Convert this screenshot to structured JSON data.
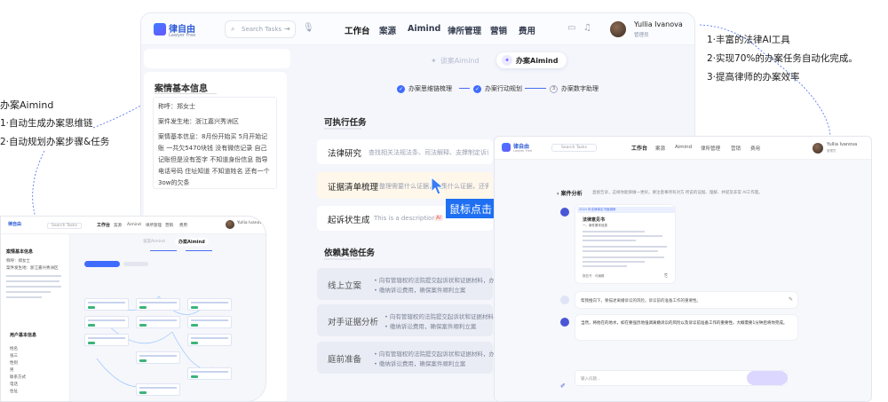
{
  "left_annotation": {
    "title": "办案Aimind",
    "lines": [
      "1·自动生成办案思维链",
      "2·自动规划办案步骤&任务"
    ]
  },
  "right_annotation": {
    "lines": [
      "1·丰富的法律AI工具",
      "2·实现70%的办案任务自动化完成。",
      "3·提高律师的办案效率"
    ]
  },
  "header": {
    "logo_name": "律自由",
    "logo_sub": "Lawyer Free",
    "search_placeholder": "Search Tasks",
    "nav": [
      "工作台",
      "案源",
      "Aimind",
      "律所管理",
      "营销",
      "费用"
    ],
    "user_name": "Yullia Ivanova",
    "user_role": "管理员"
  },
  "tabs": {
    "inactive": "谈案Aimind",
    "active": "办案Aimind"
  },
  "steps": {
    "step1": "办案思维链梳理",
    "step2": "办案行动规划",
    "step3_num": "3",
    "step3": "办案数字助理"
  },
  "case_info": {
    "title": "案情基本信息",
    "name": "称呼：郑女士",
    "location": "案件发生地：浙江嘉兴秀洲区",
    "detail": "案情基本信息：8月份开始买 5月开始记账 一共欠5470块钱 没有微信记录 自己记账但是没有签字 不知道身份信息 指导电话号码 住址知道 不知道姓名 还有一个3ow的欠条"
  },
  "executable": {
    "title": "可执行任务",
    "tasks": [
      {
        "label": "法律研究",
        "desc": "查找相关法规法条、司法解释、支撑制定诉讼策略"
      },
      {
        "label": "证据清单梳理",
        "desc": "整理需要什么证据，收集什么证据，还需要补充什么证据"
      },
      {
        "label": "起诉状生成",
        "desc": "This is a description"
      }
    ],
    "ai_badge": "AI"
  },
  "cursor_tip": "鼠标点击",
  "other": {
    "title": "依赖其他任务",
    "tasks": [
      {
        "label": "线上立案",
        "bullets": [
          "• 向有管辖权的法院提交起诉状和证据材料，办理立案手续",
          "• 缴纳诉讼费用，确保案件顺利立案"
        ]
      },
      {
        "label": "对手证据分析",
        "bullets": [
          "• 向有管辖权的法院提交起诉状和证据材料，办理立案手续",
          "• 缴纳诉讼费用，确保案件顺利立案"
        ]
      },
      {
        "label": "庭前准备",
        "bullets": [
          "• 向有管辖权的法院提交起诉状和证据材料，办理立案手续",
          "• 缴纳诉讼费用，确保案件顺利立案"
        ]
      }
    ]
  },
  "right_window": {
    "logo_name": "律自由",
    "logo_sub": "Lawyer Free",
    "search_placeholder": "Search Tasks",
    "nav": [
      "工作台",
      "案源",
      "Aimind",
      "律所管理",
      "营销",
      "费用"
    ],
    "user_name": "Yullia Ivanova",
    "user_role": "管理员",
    "section": "案件分析",
    "section_desc": "直接告诉，这样你能够做一更好。要注意事项有对方 所说的证据、理解、并提及非常 AI工作量。",
    "doc_tag": "2024 年法律事实书面调研",
    "doc_title": "法律意见书",
    "doc_sub": "一、案件基本信息",
    "doc_footer": "报告书 · 可编辑",
    "q1": "帮我推向下，要描述离婚诉讼的风险，诉讼前的准备工作的重要性。",
    "a1": "当然，将他在的地水，如在要强烈地强调离婚诉讼的风险以及诉讼前准备工作的重要性。大概需要1分钟后将你完成。",
    "input_placeholder": "输入问题..."
  },
  "left_window": {
    "logo_name": "律自由",
    "search_placeholder": "Search Tasks",
    "nav": [
      "工作台",
      "案源",
      "Aimind",
      "律所管理",
      "营销",
      "费用"
    ],
    "user_name": "Yullia Ivanova",
    "tab_inactive": "谈案Aimind",
    "tab_active": "办案Aimind",
    "case_title": "案情基本信息",
    "case_name": "称呼：郑女士",
    "case_loc": "案件发生地：浙江嘉兴秀洲区",
    "user_section": "用户基本信息",
    "user_fields": [
      "姓名",
      "张三",
      "性别",
      "男",
      "联系方式",
      "电话",
      "住址"
    ]
  }
}
